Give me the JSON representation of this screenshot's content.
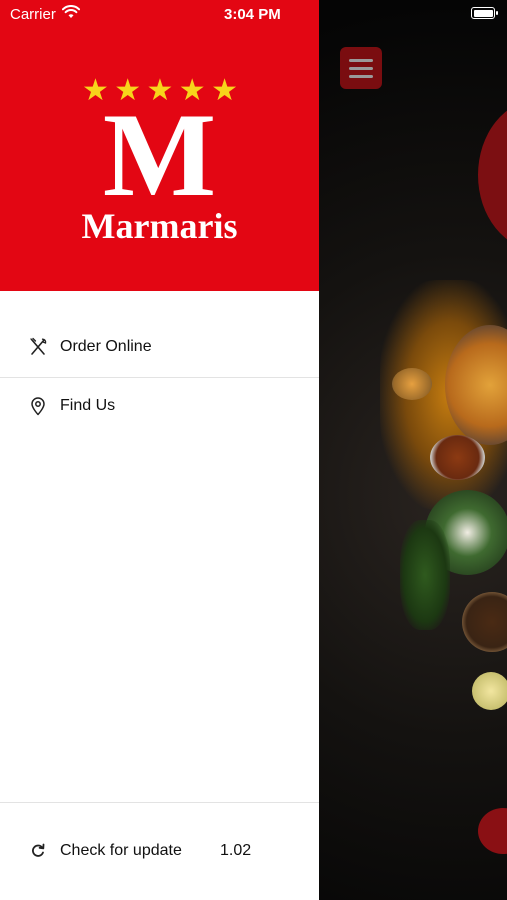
{
  "status_bar": {
    "carrier": "Carrier",
    "time": "3:04 PM"
  },
  "drawer": {
    "stars": [
      "★",
      "★",
      "★",
      "★",
      "★"
    ],
    "logo_letter": "M",
    "brand_name": "Marmaris",
    "menu": {
      "order_online": "Order Online",
      "find_us": "Find Us"
    },
    "footer": {
      "check_update": "Check for update",
      "version": "1.02"
    }
  },
  "colors": {
    "brand_red": "#e30613",
    "star_yellow": "#f7d51b",
    "menu_button": "#7a0d10"
  },
  "icons": [
    "wifi-icon",
    "battery-icon",
    "fork-knife-icon",
    "location-pin-icon",
    "refresh-icon",
    "hamburger-icon"
  ]
}
